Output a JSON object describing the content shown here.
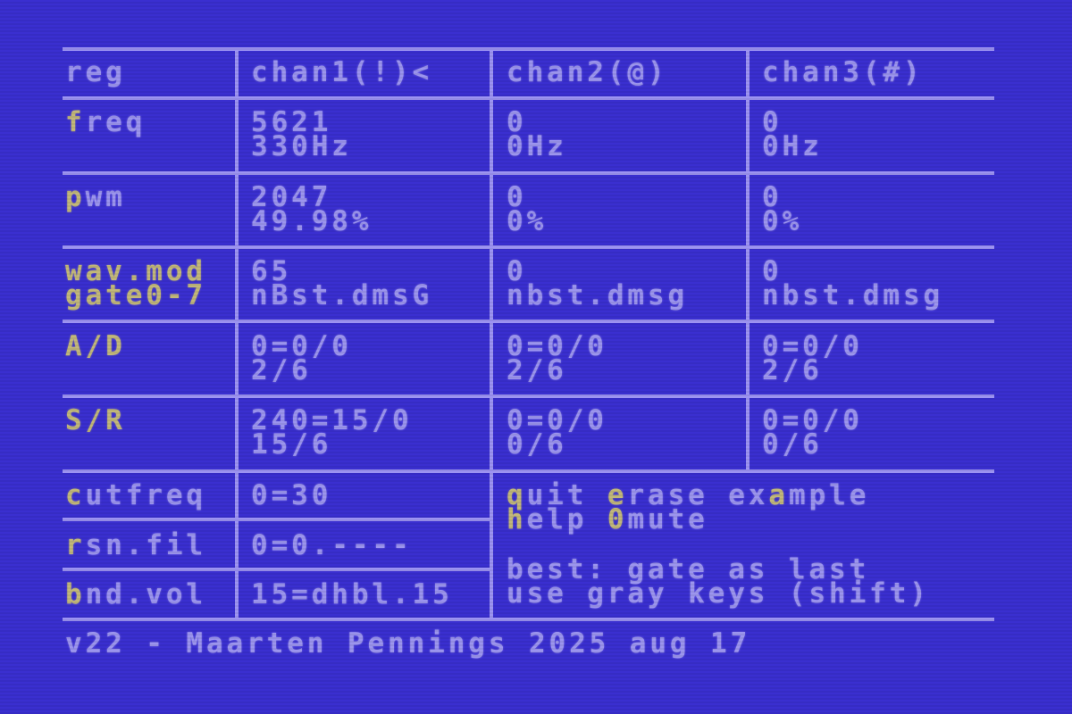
{
  "table": {
    "header": {
      "reg": "reg",
      "chan1": "chan1(!)<",
      "chan2": "chan2(@)",
      "chan3": "chan3(#)"
    },
    "rows": [
      {
        "label_key": "f",
        "label_rest": "req",
        "label2": "",
        "chan1": [
          "5621",
          "330Hz"
        ],
        "chan2": [
          "0",
          "0Hz"
        ],
        "chan3": [
          "0",
          "0Hz"
        ]
      },
      {
        "label_key": "p",
        "label_rest": "wm",
        "label2": "",
        "chan1": [
          "2047",
          "49.98%"
        ],
        "chan2": [
          "0",
          "0%"
        ],
        "chan3": [
          "0",
          "0%"
        ]
      },
      {
        "label_key": "w",
        "label_rest": "av.mod",
        "label2": "gate0-7",
        "chan1": [
          "65",
          "nBst.dmsG"
        ],
        "chan2": [
          "0",
          "nbst.dmsg"
        ],
        "chan3": [
          "0",
          "nbst.dmsg"
        ]
      },
      {
        "label_key": "A",
        "label_rest": "/D",
        "label2": "",
        "chan1": [
          "0=0/0",
          "2/6"
        ],
        "chan2": [
          "0=0/0",
          "2/6"
        ],
        "chan3": [
          "0=0/0",
          "2/6"
        ]
      },
      {
        "label_key": "S",
        "label_rest": "/R",
        "label2": "",
        "chan1": [
          "240=15/0",
          "15/6"
        ],
        "chan2": [
          "0=0/0",
          "0/6"
        ],
        "chan3": [
          "0=0/0",
          "0/6"
        ]
      }
    ],
    "filters": [
      {
        "label_key": "c",
        "label_rest": "utfreq",
        "value": "0=30"
      },
      {
        "label_key": "r",
        "label_rest": "sn.fil",
        "value": "0=0.----"
      },
      {
        "label_key": "b",
        "label_rest": "nd.vol",
        "value": "15=dhbl.15"
      }
    ]
  },
  "commands": {
    "quit_key": "q",
    "quit_rest": "uit",
    "erase_key": "e",
    "erase_rest": "rase",
    "example_pre": "ex",
    "example_key": "a",
    "example_rest": "mple",
    "help_key": "h",
    "help_rest": "elp",
    "mute_key": "0",
    "mute_rest": "mute"
  },
  "hints": {
    "line1": "best: gate as last",
    "line2": "use gray keys (shift)"
  },
  "footer": "v22 - Maarten Pennings 2025 aug 17",
  "colors": {
    "background": "#3a2fd0",
    "text": "#9c95ee",
    "highlight": "#c2b87a"
  }
}
